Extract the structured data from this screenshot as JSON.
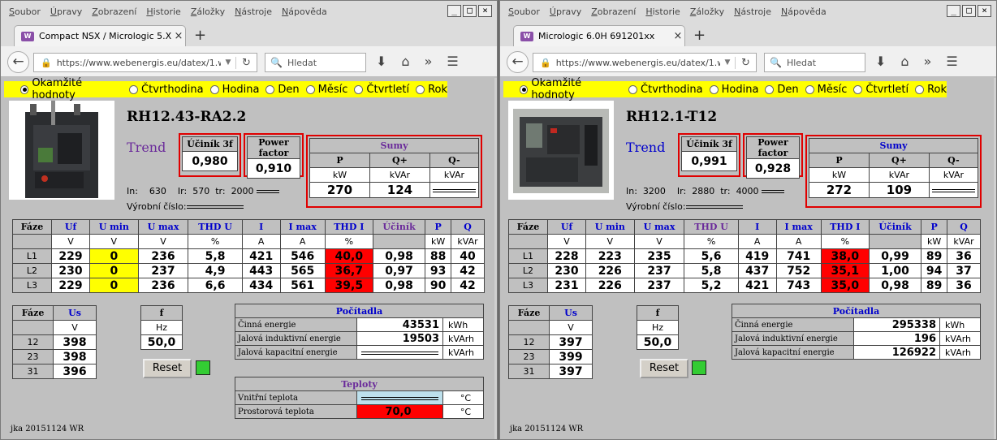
{
  "menu": [
    "Soubor",
    "Úpravy",
    "Zobrazení",
    "Historie",
    "Záložky",
    "Nástroje",
    "Nápověda"
  ],
  "window_buttons": [
    "_",
    "□",
    "×"
  ],
  "nav": {
    "back": "←",
    "lock": "🔒",
    "arrow": "▼",
    "reload": "↻",
    "search_placeholder": "Hledat",
    "search_icon": "🔍",
    "download": "⬇",
    "home": "⌂",
    "more": "»",
    "menu": "☰",
    "new_tab": "+",
    "close_tab": "×",
    "favicon": "W"
  },
  "radios": [
    "Okamžité hodnoty",
    "Čtvrthodina",
    "Hodina",
    "Den",
    "Měsíc",
    "Čtvrtletí",
    "Rok"
  ],
  "labels": {
    "trend": "Trend",
    "ucinik3f": "Účiník 3f",
    "pf": "Power factor",
    "sumy": "Sumy",
    "P": "P",
    "Qp": "Q+",
    "Qm": "Q-",
    "kW": "kW",
    "kVAr": "kVAr",
    "in": "In:",
    "ir": "Ir:",
    "tr": "tr:",
    "serial": "Výrobní číslo:",
    "faze": "Fáze",
    "uf": "Uf",
    "umin": "U min",
    "umax": "U max",
    "thdu": "THD U",
    "I": "I",
    "imax": "I max",
    "thdi": "THD I",
    "ucinik": "Účiník",
    "Q": "Q",
    "V": "V",
    "pct": "%",
    "A": "A",
    "us": "Us",
    "f": "f",
    "Hz": "Hz",
    "reset": "Reset",
    "pocitadla": "Počítadla",
    "cinna": "Činná energie",
    "jal_ind": "Jalová induktivní energie",
    "jal_kap": "Jalová kapacitní energie",
    "kWh": "kWh",
    "kVArh": "kVArh",
    "teploty": "Teploty",
    "vnitrni": "Vnitřní teplota",
    "prostorova": "Prostorová teplota",
    "degC": "°C",
    "footer": "jka 20151124 WR"
  },
  "left": {
    "tab": "Compact NSX / Micrologic 5.X...",
    "url": "https://www.webenergis.eu/datex/1.w",
    "device": "RH12.43-RA2.2",
    "pf3": "0,980",
    "pf": "0,910",
    "P": "270",
    "Qp": "124",
    "in": "630",
    "ir": "570",
    "tr": "2000",
    "phases": [
      {
        "name": "L1",
        "uf": "229",
        "umin": "0",
        "umax": "236",
        "thdu": "5,8",
        "i": "421",
        "imax": "546",
        "thdi": "40,0",
        "pf": "0,98",
        "p": "88",
        "q": "40"
      },
      {
        "name": "L2",
        "uf": "230",
        "umin": "0",
        "umax": "237",
        "thdu": "4,9",
        "i": "443",
        "imax": "565",
        "thdi": "36,7",
        "pf": "0,97",
        "p": "93",
        "q": "42"
      },
      {
        "name": "L3",
        "uf": "229",
        "umin": "0",
        "umax": "236",
        "thdu": "6,6",
        "i": "434",
        "imax": "561",
        "thdi": "39,5",
        "pf": "0,98",
        "p": "90",
        "q": "42"
      }
    ],
    "us": [
      {
        "n": "12",
        "v": "398"
      },
      {
        "n": "23",
        "v": "398"
      },
      {
        "n": "31",
        "v": "396"
      }
    ],
    "f": "50,0",
    "cinna": "43531",
    "jal_ind": "19503",
    "prostorova": "70,0"
  },
  "right": {
    "tab": "Micrologic 6.0H 691201xx",
    "url": "https://www.webenergis.eu/datex/1.w",
    "device": "RH12.1-T12",
    "pf3": "0,991",
    "pf": "0,928",
    "P": "272",
    "Qp": "109",
    "in": "3200",
    "ir": "2880",
    "tr": "4000",
    "phases": [
      {
        "name": "L1",
        "uf": "228",
        "umin": "223",
        "umax": "235",
        "thdu": "5,6",
        "i": "419",
        "imax": "741",
        "thdi": "38,0",
        "pf": "0,99",
        "p": "89",
        "q": "36"
      },
      {
        "name": "L2",
        "uf": "230",
        "umin": "226",
        "umax": "237",
        "thdu": "5,8",
        "i": "437",
        "imax": "752",
        "thdi": "35,1",
        "pf": "1,00",
        "p": "94",
        "q": "37"
      },
      {
        "name": "L3",
        "uf": "231",
        "umin": "226",
        "umax": "237",
        "thdu": "5,2",
        "i": "421",
        "imax": "743",
        "thdi": "35,0",
        "pf": "0,98",
        "p": "89",
        "q": "36"
      }
    ],
    "us": [
      {
        "n": "12",
        "v": "397"
      },
      {
        "n": "23",
        "v": "399"
      },
      {
        "n": "31",
        "v": "397"
      }
    ],
    "f": "50,0",
    "cinna": "295338",
    "jal_ind": "196",
    "jal_kap": "126922"
  },
  "colors": {
    "alarm": "#ff0000",
    "warn": "#ffff00",
    "ok": "#33cc33",
    "frame": "#e00000"
  }
}
